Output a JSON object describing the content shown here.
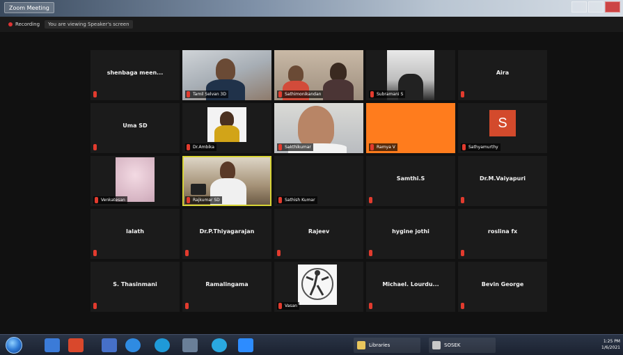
{
  "window": {
    "title": "Zoom Meeting"
  },
  "toolbar": {
    "recording_label": "Recording",
    "speaking_label": "You are viewing Speaker's screen"
  },
  "tiles": [
    {
      "name": "shenbaga meen...",
      "label": ""
    },
    {
      "name": "",
      "label": "Tamil Selvan 3D"
    },
    {
      "name": "",
      "label": "Sathimonikandan"
    },
    {
      "name": "",
      "label": "Subramani S"
    },
    {
      "name": "Aira",
      "label": ""
    },
    {
      "name": "Uma SD",
      "label": ""
    },
    {
      "name": "",
      "label": "Dr.Ambika"
    },
    {
      "name": "",
      "label": "Sakthikumar"
    },
    {
      "name": "",
      "label": "Ramya V"
    },
    {
      "name": "",
      "label": "Sathyamurthy"
    },
    {
      "name": "",
      "label": "Venkatesan"
    },
    {
      "name": "",
      "label": "Rajkumar SD"
    },
    {
      "name": "",
      "label": "Sathish Kumar"
    },
    {
      "name": "Samthi.S",
      "label": ""
    },
    {
      "name": "Dr.M.Vaiyapuri",
      "label": ""
    },
    {
      "name": "lalath",
      "label": ""
    },
    {
      "name": "Dr.P.Thiyagarajan",
      "label": ""
    },
    {
      "name": "Rajeev",
      "label": ""
    },
    {
      "name": "hygine jothi",
      "label": ""
    },
    {
      "name": "roslina fx",
      "label": ""
    },
    {
      "name": "S. Thasinmani",
      "label": ""
    },
    {
      "name": "Ramalingama",
      "label": ""
    },
    {
      "name": "",
      "label": "Vasan"
    },
    {
      "name": "Michael. Lourdu...",
      "label": ""
    },
    {
      "name": "Bevin George",
      "label": ""
    }
  ],
  "avatar": {
    "letter": "S",
    "color": "#d34a2c"
  },
  "taskbar": {
    "buttons": [
      {
        "label": "Libraries"
      },
      {
        "label": "SOSEK"
      }
    ],
    "clock": {
      "time": "1:25 PM",
      "date": "1/6/2021"
    }
  },
  "colors": {
    "speaker_outline": "#d8d436",
    "mute_icon": "#e23b2e",
    "orange_tile": "#ff7c1d"
  },
  "icons": [
    "mic-muted-icon",
    "windows-start-icon",
    "explorer-icon",
    "chrome-icon",
    "ie-icon",
    "edge-icon",
    "zoom-icon"
  ]
}
